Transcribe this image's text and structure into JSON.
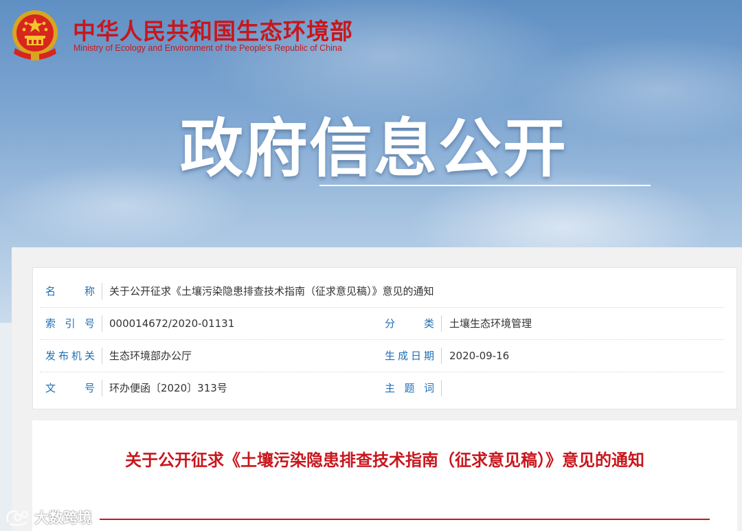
{
  "header": {
    "org_name_cn": "中华人民共和国生态环境部",
    "org_name_en": "Ministry of Ecology and Environment of the People's Republic of China",
    "banner_title": "政府信息公开",
    "emblem_icon": "national-emblem-icon"
  },
  "meta": {
    "name_label": "名称",
    "name_value": "关于公开征求《土壤污染隐患排查技术指南（征求意见稿）》意见的通知",
    "index_label": "索引号",
    "index_value": "000014672/2020-01131",
    "category_label": "分类",
    "category_value": "土壤生态环境管理",
    "issuer_label": "发布机关",
    "issuer_value": "生态环境部办公厅",
    "date_label": "生成日期",
    "date_value": "2020-09-16",
    "docno_label": "文号",
    "docno_value": "环办便函〔2020〕313号",
    "topic_label": "主题词",
    "topic_value": ""
  },
  "article": {
    "title": "关于公开征求《土壤污染隐患排查技术指南（征求意见稿）》意见的通知"
  },
  "watermark": {
    "text": "大数跨境",
    "icon": "weibo-like-logo-icon"
  },
  "colors": {
    "brand_red": "#c8161d",
    "label_blue": "#1e6fb5"
  }
}
